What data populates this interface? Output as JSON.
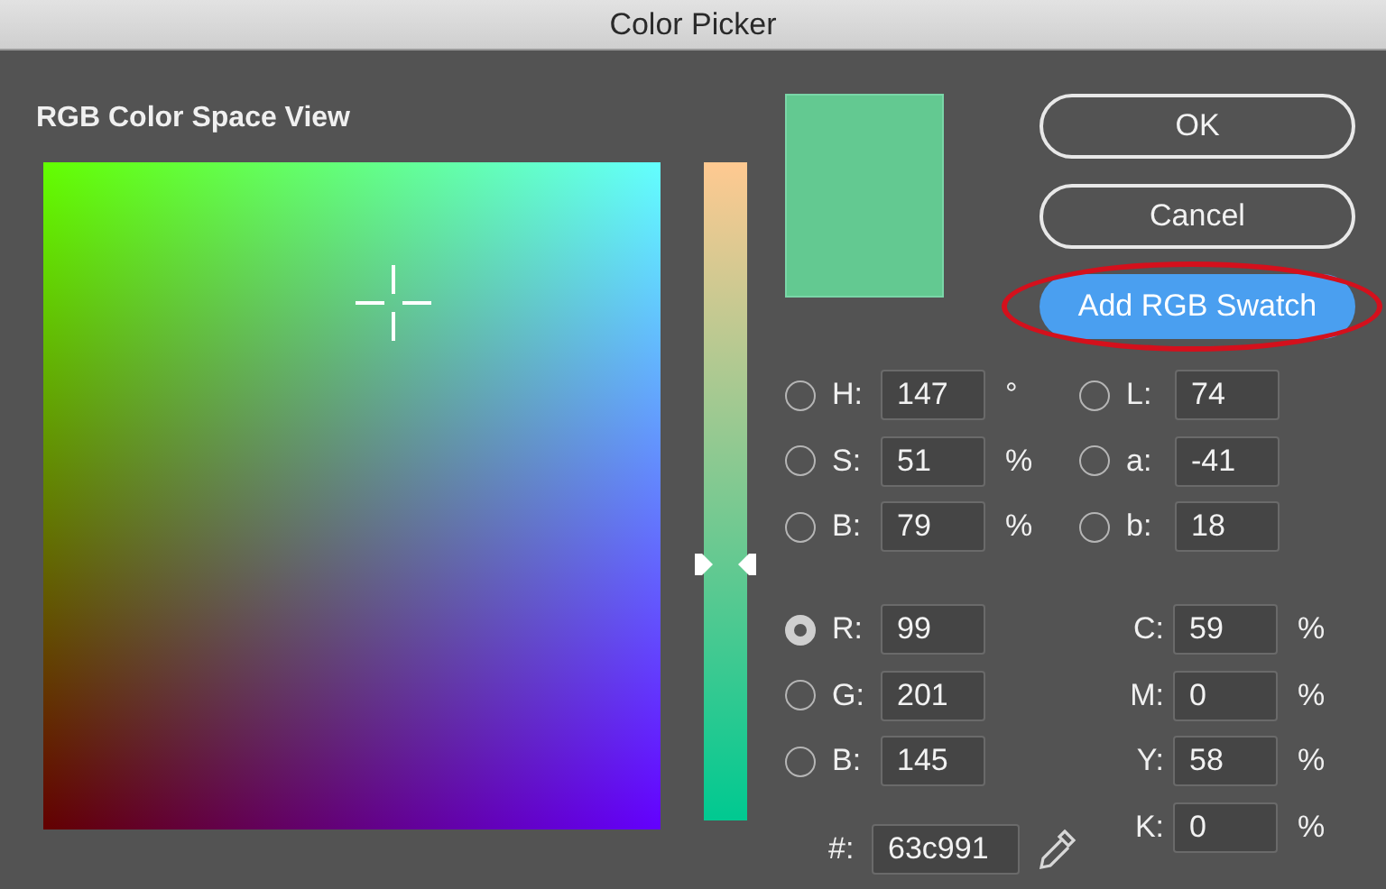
{
  "window": {
    "title": "Color Picker"
  },
  "color_view": {
    "label": "RGB Color Space View"
  },
  "slider": {
    "level": 0.39
  },
  "buttons": [
    {
      "label": "OK",
      "kind": "plain",
      "highlighted": false
    },
    {
      "label": "Cancel",
      "kind": "plain",
      "highlighted": false
    },
    {
      "label": "Add RGB Swatch",
      "kind": "default",
      "highlighted": true
    }
  ],
  "hsb": [
    {
      "label": "H:",
      "value": "147",
      "unit": "°",
      "selected": false
    },
    {
      "label": "S:",
      "value": "51",
      "unit": "%",
      "selected": false
    },
    {
      "label": "B:",
      "value": "79",
      "unit": "%",
      "selected": false
    }
  ],
  "rgb": [
    {
      "label": "R:",
      "value": "99",
      "selected": true
    },
    {
      "label": "G:",
      "value": "201",
      "selected": false
    },
    {
      "label": "B:",
      "value": "145",
      "selected": false
    }
  ],
  "lab": [
    {
      "label": "L:",
      "value": "74",
      "selected": false
    },
    {
      "label": "a:",
      "value": "-41",
      "selected": false
    },
    {
      "label": "b:",
      "value": "18",
      "selected": false
    }
  ],
  "cmyk": [
    {
      "label": "C:",
      "value": "59",
      "unit": "%"
    },
    {
      "label": "M:",
      "value": "0",
      "unit": "%"
    },
    {
      "label": "Y:",
      "value": "58",
      "unit": "%"
    },
    {
      "label": "K:",
      "value": "0",
      "unit": "%"
    }
  ],
  "hex": {
    "label": "#:",
    "value": "63c991"
  }
}
